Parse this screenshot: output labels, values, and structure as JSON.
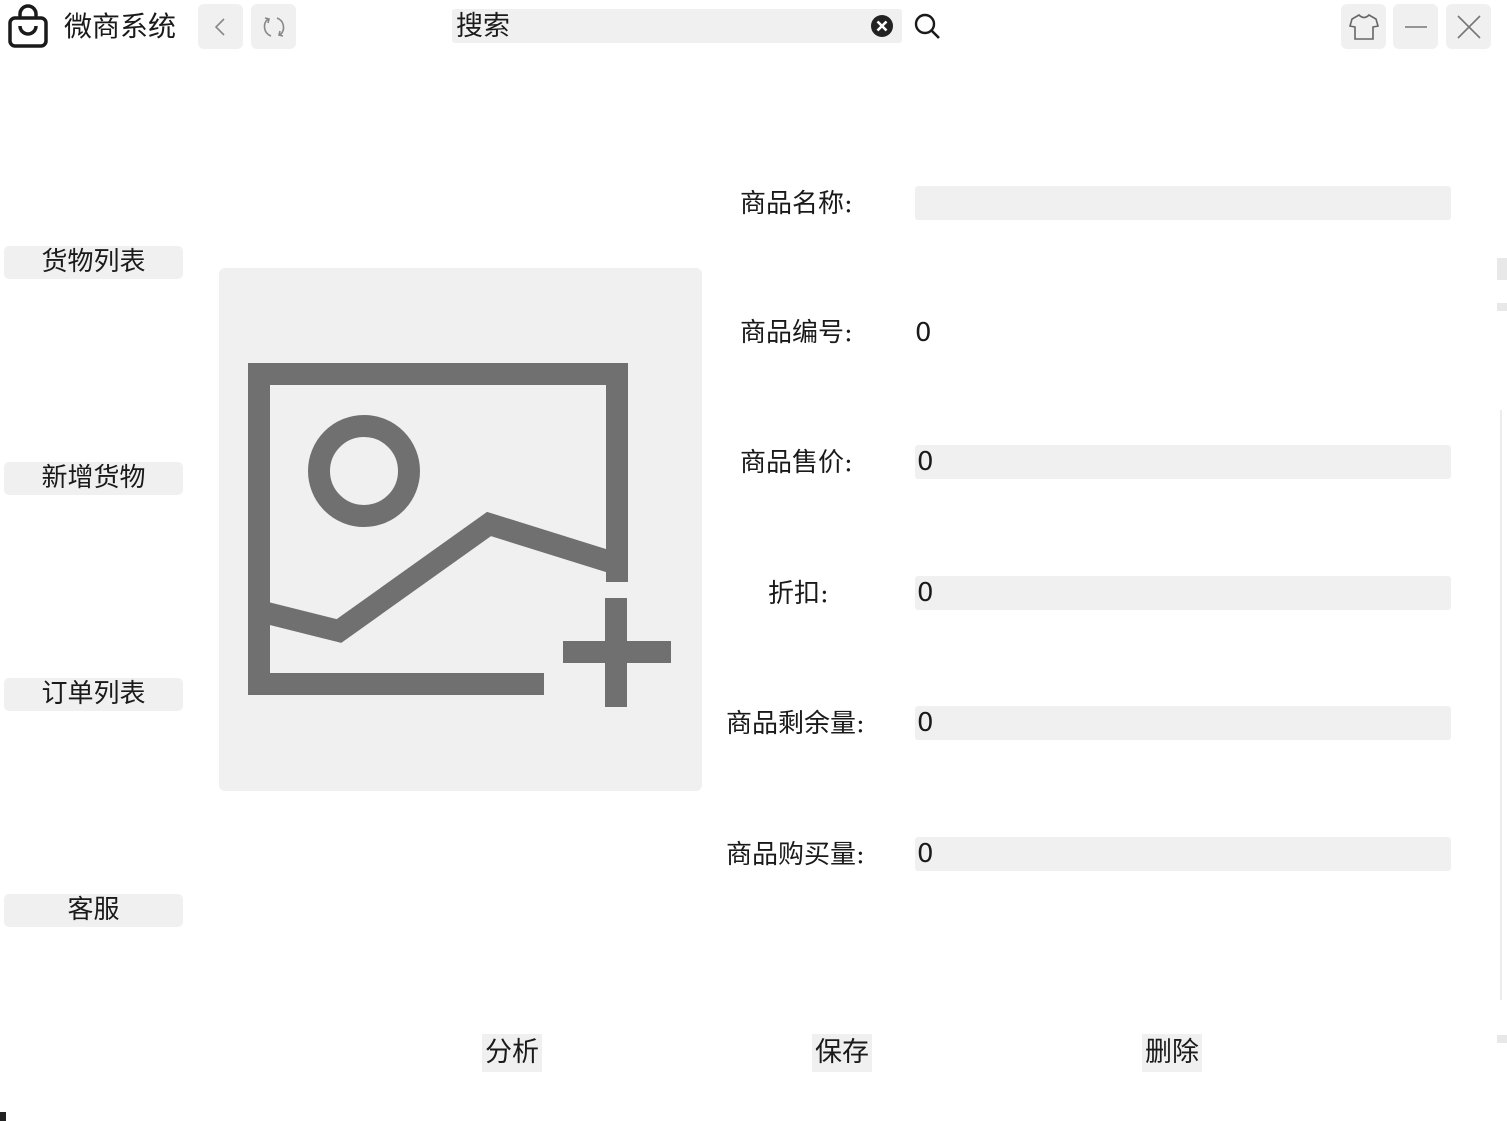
{
  "titlebar": {
    "app_name": "微商系统",
    "search": {
      "placeholder": "搜索",
      "value": ""
    }
  },
  "sidebar": {
    "items": [
      {
        "label": "货物列表"
      },
      {
        "label": "新增货物"
      },
      {
        "label": "订单列表"
      },
      {
        "label": "客服"
      }
    ]
  },
  "form": {
    "name": {
      "label": "商品名称:",
      "value": ""
    },
    "number": {
      "label": "商品编号:",
      "value": "0"
    },
    "price": {
      "label": "商品售价:",
      "value": "0"
    },
    "discount": {
      "label": "折扣:",
      "value": "0"
    },
    "stock": {
      "label": "商品剩余量:",
      "value": "0"
    },
    "purchased": {
      "label": "商品购买量:",
      "value": "0"
    }
  },
  "actions": {
    "analyze": "分析",
    "save": "保存",
    "delete": "删除"
  },
  "colors": {
    "control_bg": "#f0f0f0",
    "icon_gray": "#707070",
    "text": "#1a1a1a"
  }
}
